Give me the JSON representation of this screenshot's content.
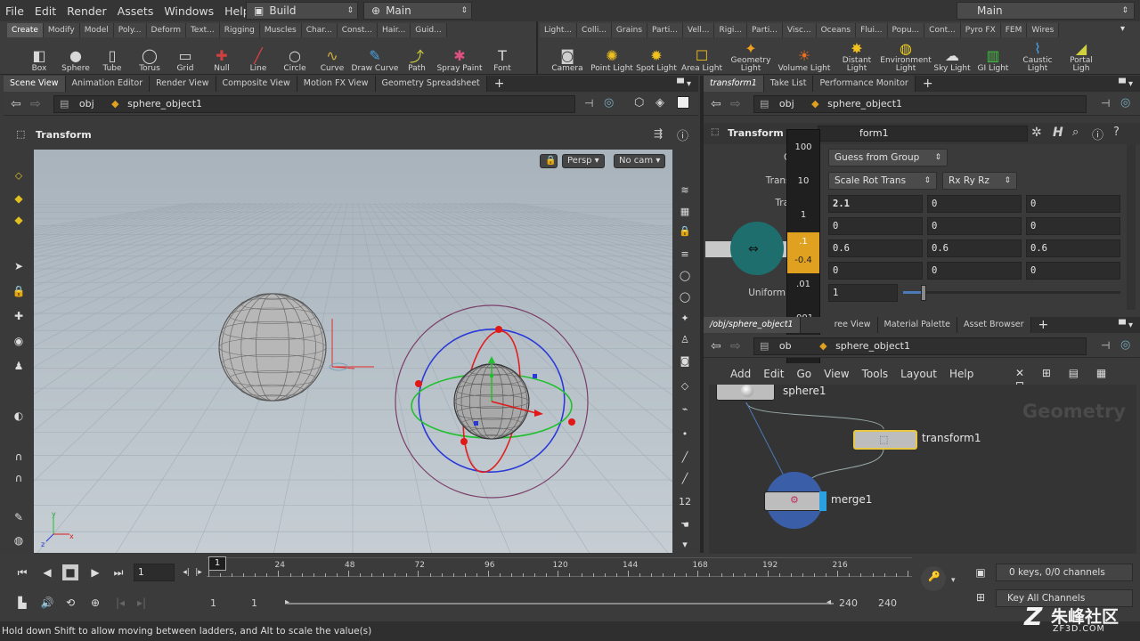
{
  "menubar": {
    "items": [
      "File",
      "Edit",
      "Render",
      "Assets",
      "Windows",
      "Help"
    ],
    "desktop_build": "Build",
    "desktop_main": "Main",
    "desktop_right": "Main"
  },
  "shelf_left": {
    "tabs": [
      "Create",
      "Modify",
      "Model",
      "Poly...",
      "Deform",
      "Text...",
      "Rigging",
      "Muscles",
      "Char...",
      "Const...",
      "Hair...",
      "Guid..."
    ],
    "tools": [
      {
        "label": "Box",
        "icon": "box-icon"
      },
      {
        "label": "Sphere",
        "icon": "sphere-icon"
      },
      {
        "label": "Tube",
        "icon": "tube-icon"
      },
      {
        "label": "Torus",
        "icon": "torus-icon"
      },
      {
        "label": "Grid",
        "icon": "grid-icon"
      },
      {
        "label": "Null",
        "icon": "null-icon"
      },
      {
        "label": "Line",
        "icon": "line-icon"
      },
      {
        "label": "Circle",
        "icon": "circle-icon"
      },
      {
        "label": "Curve",
        "icon": "curve-icon"
      },
      {
        "label": "Draw Curve",
        "icon": "draw-curve-icon"
      },
      {
        "label": "Path",
        "icon": "path-icon"
      },
      {
        "label": "Spray Paint",
        "icon": "spray-paint-icon"
      },
      {
        "label": "Font",
        "icon": "font-icon"
      }
    ]
  },
  "shelf_right": {
    "tabs": [
      "Light...",
      "Colli...",
      "Grains",
      "Parti...",
      "Vell...",
      "Rigi...",
      "Parti...",
      "Visc...",
      "Oceans",
      "Flui...",
      "Popu...",
      "Cont...",
      "Pyro FX",
      "FEM",
      "Wires"
    ],
    "tools": [
      {
        "label": "Camera",
        "icon": "camera-icon"
      },
      {
        "label": "Point Light",
        "icon": "point-light-icon"
      },
      {
        "label": "Spot Light",
        "icon": "spot-light-icon"
      },
      {
        "label": "Area Light",
        "icon": "area-light-icon"
      },
      {
        "label": "Geometry Light",
        "icon": "geometry-light-icon"
      },
      {
        "label": "Volume Light",
        "icon": "volume-light-icon"
      },
      {
        "label": "Distant Light",
        "icon": "distant-light-icon"
      },
      {
        "label": "Environment Light",
        "icon": "environment-light-icon"
      },
      {
        "label": "Sky Light",
        "icon": "sky-light-icon"
      },
      {
        "label": "GI Light",
        "icon": "gi-light-icon"
      },
      {
        "label": "Caustic Light",
        "icon": "caustic-light-icon"
      },
      {
        "label": "Portal Ligh",
        "icon": "portal-light-icon"
      }
    ]
  },
  "left_pane": {
    "tabs": [
      "Scene View",
      "Animation Editor",
      "Render View",
      "Composite View",
      "Motion FX View",
      "Geometry Spreadsheet"
    ],
    "path_obj": "obj",
    "path_node": "sphere_object1",
    "tool_title": "Transform",
    "persp_btn": "Persp",
    "cam_btn": "No cam"
  },
  "param_pane": {
    "tabs": [
      "transform1",
      "Take List",
      "Performance Monitor"
    ],
    "path_obj": "obj",
    "path_node": "sphere_object1",
    "node_type": "Transform",
    "node_name": "transform1",
    "node_name_visible": "form1",
    "group_label": "Group",
    "group_value": "Guess from Group",
    "transform_label": "Transform",
    "transform_value": "Scale Rot Trans",
    "rot_value": "Rx Ry Rz",
    "translate_label": "Tra",
    "uniform_label": "Uniform",
    "uniform_value": "1",
    "rows": [
      [
        "2.1",
        "0",
        "0"
      ],
      [
        "0",
        "0",
        "0"
      ],
      [
        "0.6",
        "0.6",
        "0.6"
      ],
      [
        "0",
        "0",
        "0"
      ]
    ]
  },
  "ladder": {
    "steps": [
      "100",
      "10",
      "1",
      ".1",
      ".01",
      ".001",
      ".0001"
    ],
    "active_value": "-0.4",
    "active_step": ".1"
  },
  "network_pane": {
    "tabs": [
      "/obj/sphere_object1",
      "ree View",
      "Material Palette",
      "Asset Browser"
    ],
    "path_obj": "ob",
    "path_node": "sphere_object1",
    "menu": [
      "Add",
      "Edit",
      "Go",
      "View",
      "Tools",
      "Layout",
      "Help"
    ],
    "context_label": "Geometry",
    "nodes": [
      "sphere1",
      "transform1",
      "merge1"
    ]
  },
  "timeline": {
    "current_frame": "1",
    "frame_marker": "1",
    "ticks": [
      "24",
      "48",
      "72",
      "96",
      "120",
      "144",
      "168",
      "192",
      "216"
    ],
    "start_frame": "1",
    "start_frame2": "1",
    "end_frame": "240",
    "end_frame2": "240",
    "keys_info": "0 keys, 0/0 channels",
    "key_all": "Key All Channels"
  },
  "status": {
    "message": "Hold down Shift to allow moving between ladders, and Alt to scale the value(s)"
  },
  "watermark": {
    "text": "朱峰社区",
    "url": "ZF3D.COM"
  },
  "colors": {
    "accent_orange": "#e0a020",
    "selected_node": "#e8c840",
    "viewport_sky": "#b3bdc5"
  }
}
